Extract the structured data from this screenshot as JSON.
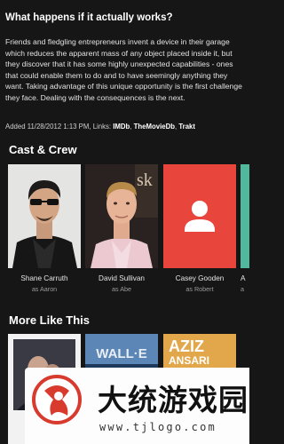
{
  "overview": {
    "tagline": "What happens if it actually works?",
    "summary": "Friends and fledgling entrepreneurs invent a device in their garage which reduces the apparent mass of any object placed inside it, but they discover that it has some highly unexpected capabilities - ones that could enable them to do and to have seemingly anything they want. Taking advantage of this unique opportunity is the first challenge they face. Dealing with the consequences is the next.",
    "added_prefix": "Added 11/28/2012 1:13 PM, Links: ",
    "links": [
      "IMDb",
      "TheMovieDb",
      "Trakt"
    ],
    "link_separator": ", "
  },
  "cast": {
    "title": "Cast & Crew",
    "people": [
      {
        "name": "Shane Carruth",
        "role": "as Aaron"
      },
      {
        "name": "David Sullivan",
        "role": "as Abe"
      },
      {
        "name": "Casey Gooden",
        "role": "as Robert"
      },
      {
        "name": "A",
        "role": "a"
      }
    ],
    "banner_fragment": "sk"
  },
  "more_like_this": {
    "title": "More Like This",
    "posters": [
      {
        "title": ""
      },
      {
        "title": "WALL·E"
      },
      {
        "title": "AZIZ",
        "subtitle": "ANSARI"
      },
      {
        "title": ""
      }
    ]
  },
  "watermark": {
    "name": "大统游戏园",
    "url": "www.tjlogo.com"
  },
  "colors": {
    "background": "#161616",
    "placeholder_red": "#e8453c",
    "placeholder_teal": "#4fb89d"
  }
}
